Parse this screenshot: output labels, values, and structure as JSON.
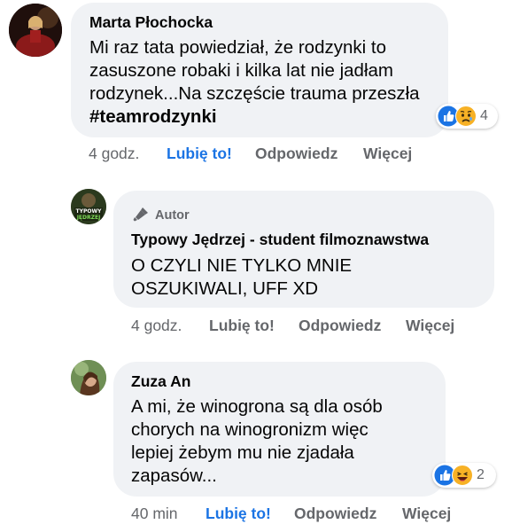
{
  "comments": [
    {
      "author": "Marta Płochocka",
      "text_before": "Mi raz tata powiedział, że rodzynki to zasuszone robaki i kilka lat nie jadłam rodzynek...Na szczęście trauma przeszła ",
      "hashtag": "#teamrodzynki",
      "reaction_count": "4",
      "reactions": [
        "like-icon",
        "sad-icon"
      ],
      "time": "4 godz.",
      "like_label": "Lubię to!",
      "reply_label": "Odpowiedz",
      "more_label": "Więcej"
    },
    {
      "badge": "Autor",
      "author": "Typowy Jędrzej - student filmoznawstwa",
      "text": "O CZYLI NIE TYLKO MNIE OSZUKIWALI, UFF XD",
      "avatar_text_top": "TYPOWY",
      "avatar_text_bottom": "JĘDRZEJ",
      "time": "4 godz.",
      "like_label": "Lubię to!",
      "reply_label": "Odpowiedz",
      "more_label": "Więcej"
    },
    {
      "author": "Zuza An",
      "text": "A mi, że winogrona są dla osób chorych na winogronizm więc lepiej żebym mu nie zjadała zapasów...",
      "reaction_count": "2",
      "reactions": [
        "like-icon",
        "haha-icon"
      ],
      "time": "40 min",
      "like_label": "Lubię to!",
      "reply_label": "Odpowiedz",
      "more_label": "Więcej"
    }
  ],
  "colors": {
    "like_blue": "#1b74e4",
    "bubble_bg": "#f0f2f5",
    "secondary_text": "#65676b",
    "reaction_yellow": "#f7b125"
  }
}
